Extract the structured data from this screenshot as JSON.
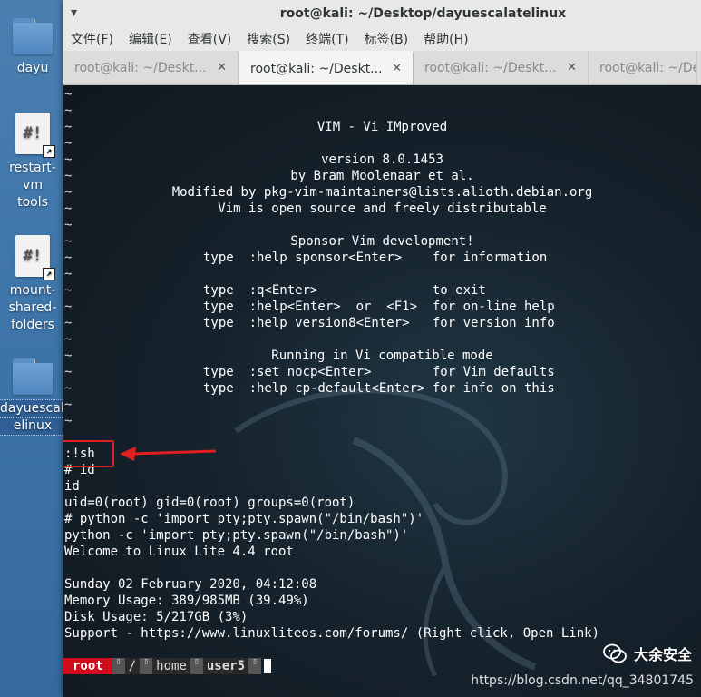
{
  "desktop": {
    "icons": [
      {
        "label_lines": [
          "dayu"
        ],
        "kind": "folder-icon"
      },
      {
        "label_lines": [
          "restart-vm",
          "tools"
        ],
        "kind": "script-icon"
      },
      {
        "label_lines": [
          "mount-",
          "shared-",
          "folders"
        ],
        "kind": "script-icon"
      },
      {
        "label_lines": [
          "dayuescalat",
          "elinux"
        ],
        "kind": "folder-icon"
      }
    ]
  },
  "window": {
    "title": "root@kali: ~/Desktop/dayuescalatelinux",
    "menu": [
      "文件(F)",
      "编辑(E)",
      "查看(V)",
      "搜索(S)",
      "终端(T)",
      "标签(B)",
      "帮助(H)"
    ],
    "tabs": [
      {
        "label": "root@kali: ~/Deskt...",
        "active": false
      },
      {
        "label": "root@kali: ~/Deskt...",
        "active": true
      },
      {
        "label": "root@kali: ~/Deskt...",
        "active": false
      },
      {
        "label": "root@kali: ~/Deskt",
        "active": false
      }
    ],
    "tab_close": "✕"
  },
  "terminal": {
    "tilde": "~",
    "splash": {
      "title": "VIM - Vi IMproved",
      "version": "version 8.0.1453",
      "author": "by Bram Moolenaar et al.",
      "modified": "Modified by pkg-vim-maintainers@lists.alioth.debian.org",
      "open_source": "Vim is open source and freely distributable",
      "sponsor": "Sponsor Vim development!",
      "help_sponsor": "type  :help sponsor<Enter>    for information",
      "help_exit": "type  :q<Enter>               to exit",
      "help_online": "type  :help<Enter>  or  <F1>  for on-line help",
      "help_version": "type  :help version8<Enter>   for version info",
      "compat": "Running in Vi compatible mode",
      "help_nocp": "type  :set nocp<Enter>        for Vim defaults",
      "help_cp": "type  :help cp-default<Enter> for info on this"
    },
    "output": [
      ":!sh",
      "# id",
      "id",
      "uid=0(root) gid=0(root) groups=0(root)",
      "# python -c 'import pty;pty.spawn(\"/bin/bash\")'",
      "python -c 'import pty;pty.spawn(\"/bin/bash\")'",
      "Welcome to Linux Lite 4.4 root",
      "",
      "Sunday 02 February 2020, 04:12:08",
      "Memory Usage: 389/985MB (39.49%)",
      "Disk Usage: 5/217GB (3%)",
      "Support - https://www.linuxliteos.com/forums/ (Right click, Open Link)"
    ],
    "status": {
      "user": "root",
      "root_dir": "/",
      "dir": "home",
      "current": "user5"
    }
  },
  "watermark": {
    "brand": "大余安全",
    "url": "https://blog.csdn.net/qq_34801745"
  },
  "colors": {
    "highlight": "#e02020",
    "status_root_bg": "#d00d1d"
  }
}
